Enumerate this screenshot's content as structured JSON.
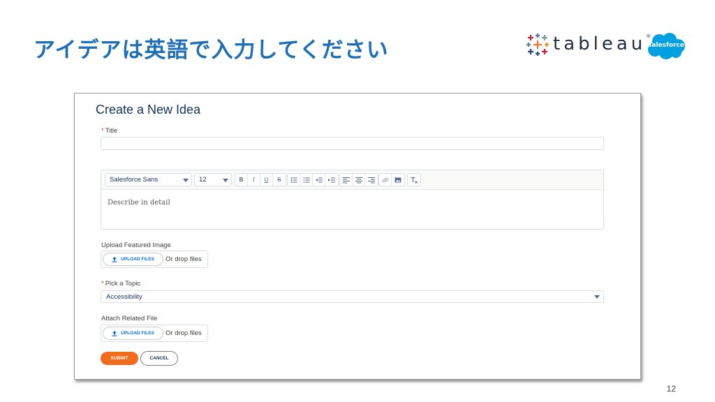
{
  "slide": {
    "title": "アイデアは英語で入力してください",
    "page_number": "12",
    "logos": {
      "tableau": "tableau",
      "tableau_tm": "®",
      "salesforce": "salesforce"
    }
  },
  "form": {
    "heading": "Create a New Idea",
    "required_marker": "*",
    "title_label": "Title",
    "title_value": "",
    "editor": {
      "font_family": "Salesforce Sans",
      "font_size": "12",
      "placeholder": "Describe in detail",
      "toolbar_icons": [
        "bold-icon",
        "italic-icon",
        "underline-icon",
        "strikethrough-icon",
        "bulleted-list-icon",
        "numbered-list-icon",
        "outdent-icon",
        "indent-icon",
        "align-left-icon",
        "align-center-icon",
        "align-right-icon",
        "link-icon",
        "image-icon",
        "clear-formatting-icon"
      ]
    },
    "featured_image": {
      "label": "Upload Featured Image",
      "button": "UPLOAD FILES",
      "drop_text": "Or drop files"
    },
    "topic": {
      "label": "Pick a Topic",
      "selected": "Accessibility"
    },
    "related_file": {
      "label": "Attach Related File",
      "button": "UPLOAD FILES",
      "drop_text": "Or drop files"
    },
    "submit_label": "SUBMIT",
    "cancel_label": "CANCEL"
  },
  "colors": {
    "slide_title": "#1f6fb6",
    "submit": "#f26b1d",
    "salesforce_blue": "#00a1e0",
    "link_blue": "#0070d2"
  }
}
